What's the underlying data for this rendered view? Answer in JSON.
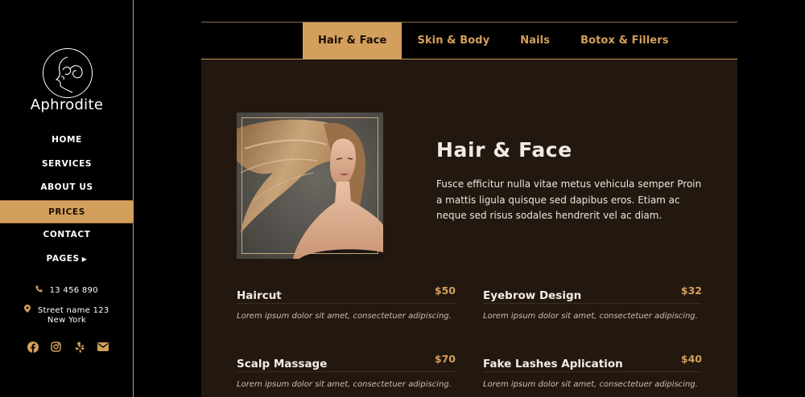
{
  "sidebar": {
    "brand": "Aphrodite",
    "nav": [
      "HOME",
      "SERVICES",
      "ABOUT US",
      "PRICES",
      "CONTACT",
      "PAGES"
    ],
    "active_nav": "PRICES",
    "phone": "13 456 890",
    "address_line1": "Street name 123",
    "address_line2": "New York",
    "socials": [
      "facebook-icon",
      "instagram-icon",
      "yelp-icon",
      "email-icon"
    ]
  },
  "tabs": [
    "Hair & Face",
    "Skin & Body",
    "Nails",
    "Botox & Fillers"
  ],
  "active_tab": "Hair & Face",
  "section": {
    "title": "Hair & Face",
    "description": "Fusce efficitur nulla vitae metus vehicula semper Proin a mattis ligula quisque sed dapibus eros. Etiam ac neque sed risus sodales hendrerit vel ac diam."
  },
  "prices": [
    {
      "name": "Haircut",
      "price": "$50",
      "note": "Lorem ipsum dolor sit amet, consectetuer adipiscing."
    },
    {
      "name": "Eyebrow Design",
      "price": "$32",
      "note": "Lorem ipsum dolor sit amet, consectetuer adipiscing."
    },
    {
      "name": "Scalp Massage",
      "price": "$70",
      "note": "Lorem ipsum dolor sit amet, consectetuer adipiscing."
    },
    {
      "name": "Fake Lashes Aplication",
      "price": "$40",
      "note": "Lorem ipsum dolor sit amet, consectetuer adipiscing."
    }
  ],
  "colors": {
    "accent": "#d39f5c",
    "panel": "#23180f",
    "background": "#000000"
  }
}
